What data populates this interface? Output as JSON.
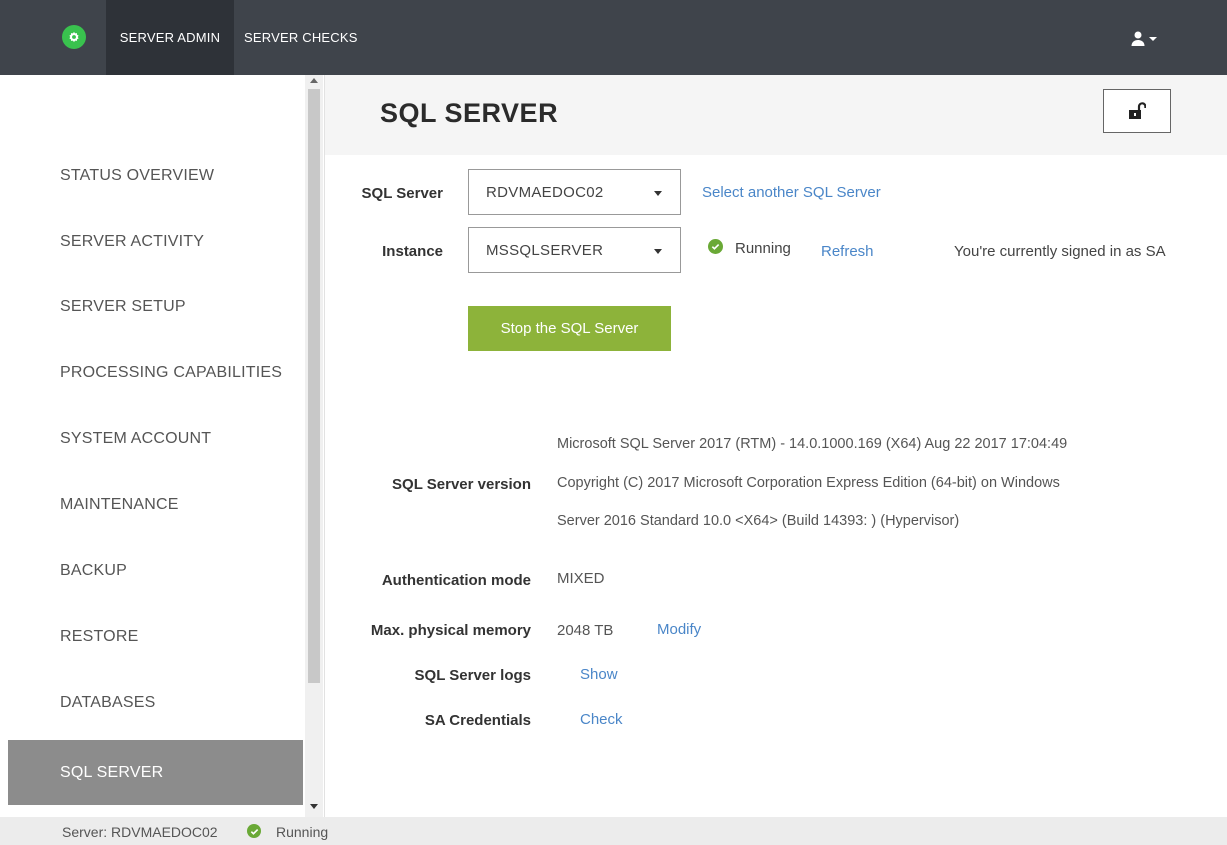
{
  "topbar": {
    "tab_admin": "SERVER ADMIN",
    "tab_checks": "SERVER CHECKS",
    "logo_icon": "gear-icon",
    "user_icon": "user-icon"
  },
  "sidebar": {
    "items": [
      {
        "label": "STATUS OVERVIEW"
      },
      {
        "label": "SERVER ACTIVITY"
      },
      {
        "label": "SERVER SETUP"
      },
      {
        "label": "PROCESSING CAPABILITIES"
      },
      {
        "label": "SYSTEM ACCOUNT"
      },
      {
        "label": "MAINTENANCE"
      },
      {
        "label": "BACKUP"
      },
      {
        "label": "RESTORE"
      },
      {
        "label": "DATABASES"
      },
      {
        "label": "SQL SERVER"
      }
    ],
    "active_index": 9
  },
  "main": {
    "title": "SQL SERVER",
    "lock_icon": "unlock-icon",
    "sql_server": {
      "label": "SQL Server",
      "value": "RDVMAEDOC02",
      "link": "Select another SQL Server"
    },
    "instance": {
      "label": "Instance",
      "value": "MSSQLSERVER",
      "status": "Running",
      "refresh": "Refresh",
      "signed_in": "You're currently signed in as SA"
    },
    "stop_button": "Stop the SQL Server",
    "version": {
      "label": "SQL Server version",
      "lines": [
        "Microsoft SQL Server 2017 (RTM) - 14.0.1000.169 (X64) Aug 22 2017 17:04:49",
        "Copyright (C) 2017 Microsoft Corporation Express Edition (64-bit) on Windows",
        "Server 2016 Standard 10.0 <X64> (Build 14393: ) (Hypervisor)"
      ]
    },
    "auth": {
      "label": "Authentication mode",
      "value": "MIXED"
    },
    "memory": {
      "label": "Max. physical memory",
      "value": "2048 TB",
      "link": "Modify"
    },
    "logs": {
      "label": "SQL Server logs",
      "link": "Show"
    },
    "credentials": {
      "label": "SA Credentials",
      "link": "Check"
    }
  },
  "statusbar": {
    "server": "Server: RDVMAEDOC02",
    "status": "Running"
  },
  "colors": {
    "topbar": "#3f444b",
    "accent_green": "#8db33a",
    "link_blue": "#4a86c8",
    "active_item": "#8c8c8c"
  }
}
